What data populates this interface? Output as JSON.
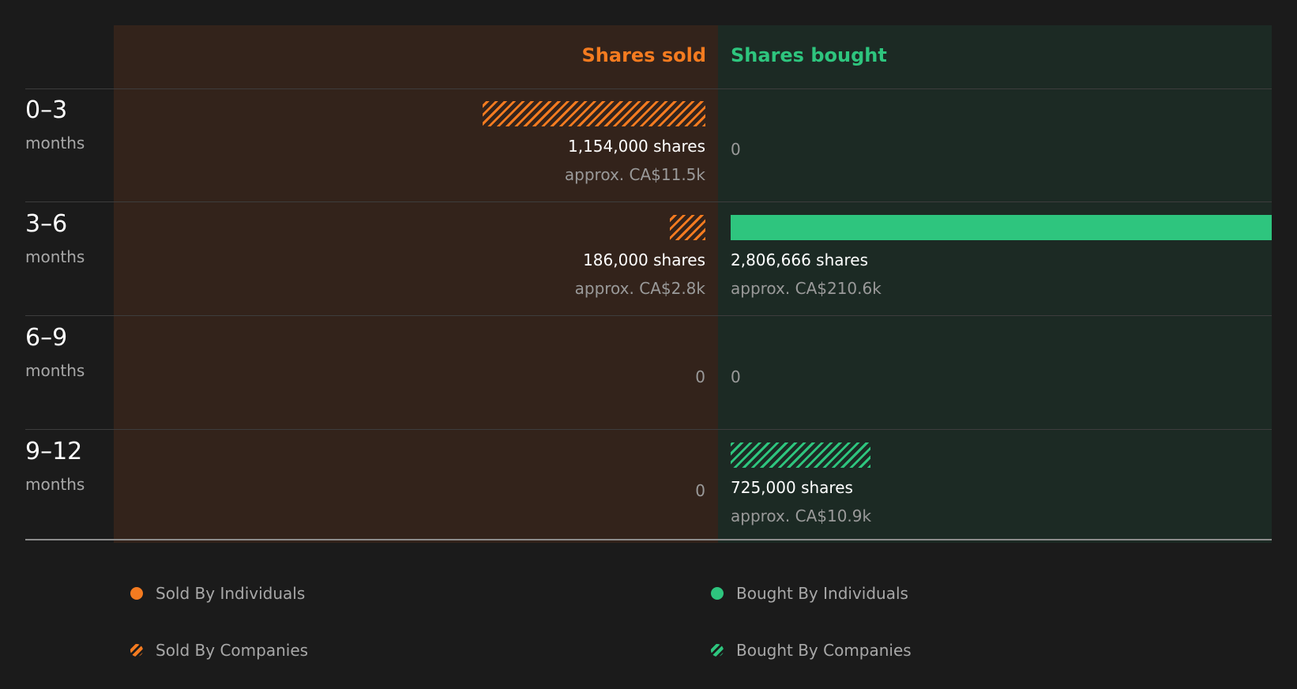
{
  "chart_data": {
    "type": "bar",
    "layout": "diverging-horizontal",
    "title": "",
    "headers": {
      "sold": "Shares sold",
      "bought": "Shares bought"
    },
    "categories": [
      {
        "range": "0-3",
        "unit": "months"
      },
      {
        "range": "3-6",
        "unit": "months"
      },
      {
        "range": "6-9",
        "unit": "months"
      },
      {
        "range": "9-12",
        "unit": "months"
      }
    ],
    "series": [
      {
        "name": "Sold By Individuals",
        "side": "sold",
        "fill": "solid",
        "values": [
          0,
          0,
          0,
          0
        ]
      },
      {
        "name": "Sold By Companies",
        "side": "sold",
        "fill": "hatched",
        "values": [
          1154000,
          186000,
          0,
          0
        ]
      },
      {
        "name": "Bought By Individuals",
        "side": "bought",
        "fill": "solid",
        "values": [
          0,
          2806666,
          0,
          0
        ]
      },
      {
        "name": "Bought By Companies",
        "side": "bought",
        "fill": "hatched",
        "values": [
          0,
          0,
          0,
          725000
        ]
      }
    ],
    "sold_labels": [
      {
        "shares": "1,154,000 shares",
        "value": "approx. CA$11.5k"
      },
      {
        "shares": "186,000 shares",
        "value": "approx. CA$2.8k"
      },
      {
        "shares": "",
        "value": "",
        "zero": "0"
      },
      {
        "shares": "",
        "value": "",
        "zero": "0"
      }
    ],
    "bought_labels": [
      {
        "shares": "",
        "value": "",
        "zero": "0"
      },
      {
        "shares": "2,806,666 shares",
        "value": "approx. CA$210.6k"
      },
      {
        "shares": "",
        "value": "",
        "zero": "0"
      },
      {
        "shares": "725,000 shares",
        "value": "approx. CA$10.9k"
      }
    ],
    "xlim": [
      0,
      2806666
    ],
    "grid": false,
    "legend_position": "bottom"
  },
  "colors": {
    "sold": "#f47b20",
    "bought": "#2ec57e",
    "sold_panel": "#33231b",
    "bought_panel": "#1c2a24",
    "background": "#1b1b1b"
  }
}
